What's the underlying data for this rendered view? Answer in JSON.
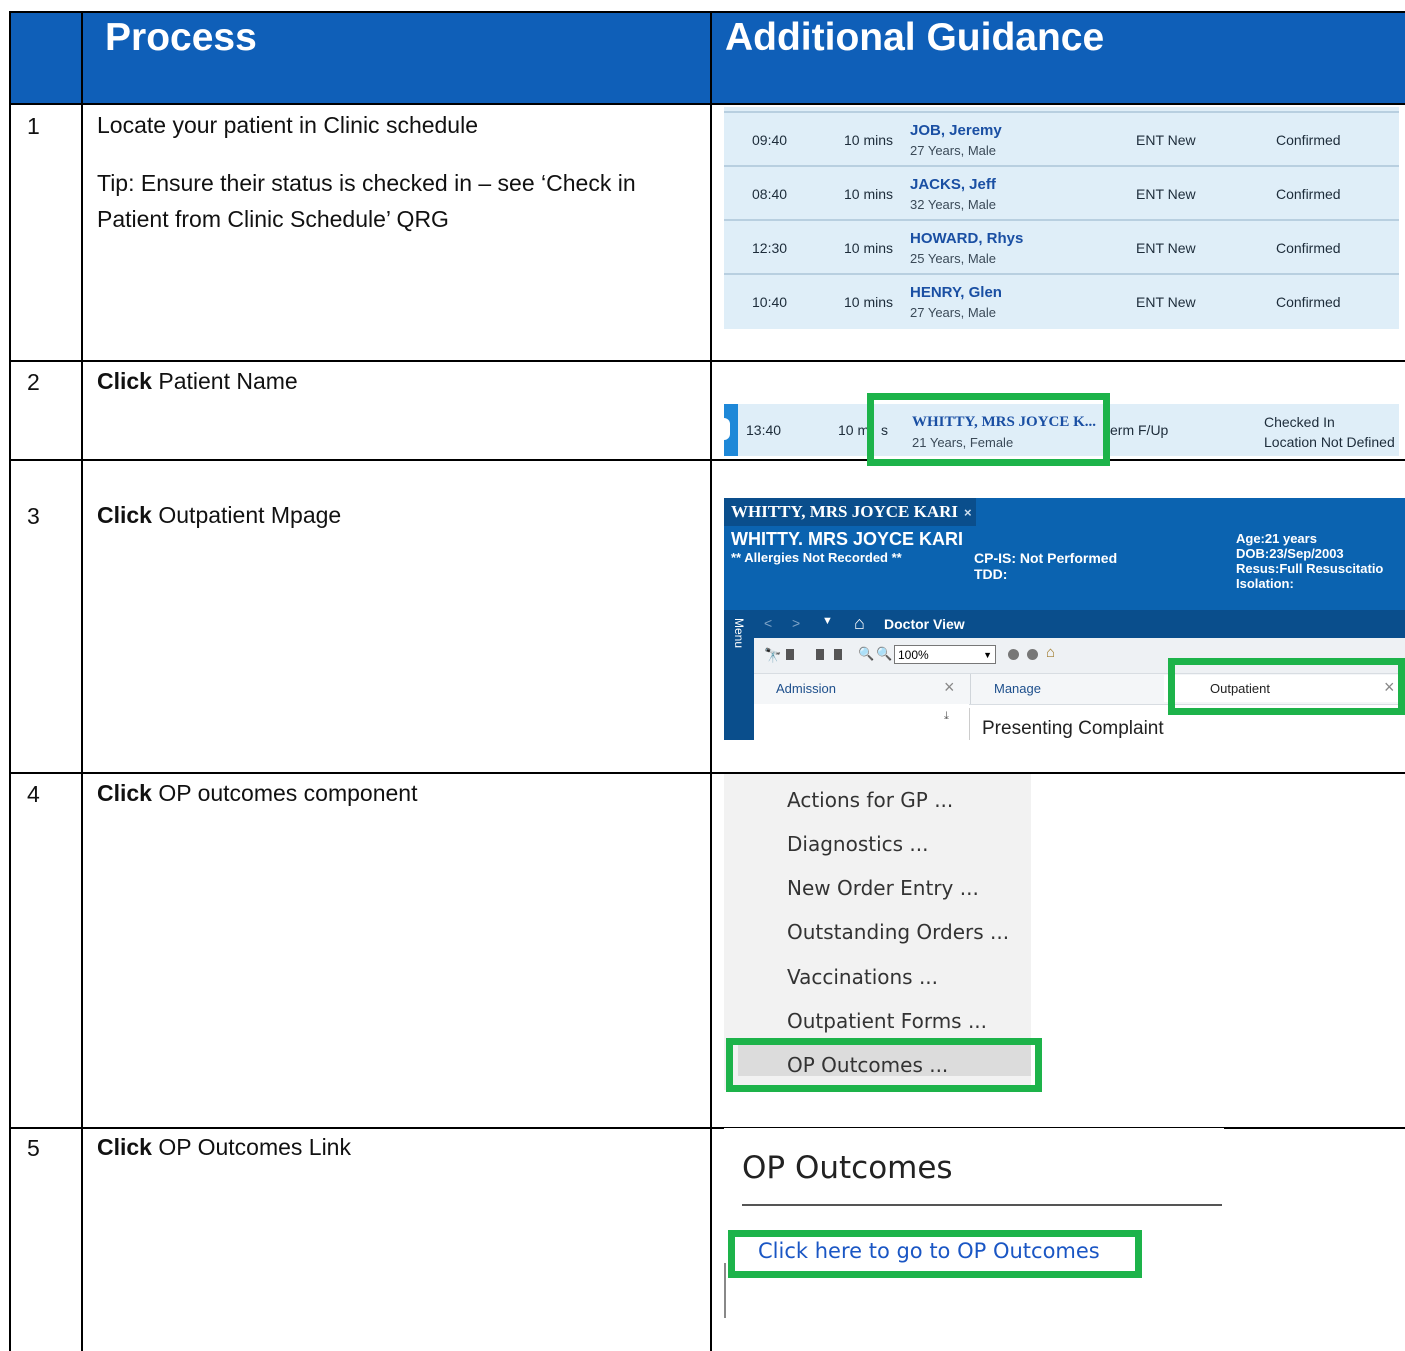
{
  "header": {
    "process": "Process",
    "guidance": "Additional Guidance"
  },
  "steps": [
    {
      "num": "1",
      "text": "Locate your patient in Clinic schedule",
      "tip": "Tip: Ensure their status is checked in  – see ‘Check in Patient from Clinic Schedule’ QRG"
    },
    {
      "num": "2",
      "bold": "Click",
      "text": " Patient Name"
    },
    {
      "num": "3",
      "bold": "Click",
      "text": " Outpatient Mpage"
    },
    {
      "num": "4",
      "bold": "Click",
      "text": " OP outcomes component"
    },
    {
      "num": "5",
      "bold": "Click",
      "text": " OP Outcomes Link"
    }
  ],
  "schedule": [
    {
      "time": "09:40",
      "dur": "10 mins",
      "name": "JOB, Jeremy",
      "sub": "27 Years, Male",
      "type": "ENT New",
      "status": "Confirmed"
    },
    {
      "time": "08:40",
      "dur": "10 mins",
      "name": "JACKS, Jeff",
      "sub": "32 Years, Male",
      "type": "ENT New",
      "status": "Confirmed"
    },
    {
      "time": "12:30",
      "dur": "10 mins",
      "name": "HOWARD, Rhys",
      "sub": "25 Years, Male",
      "type": "ENT New",
      "status": "Confirmed"
    },
    {
      "time": "10:40",
      "dur": "10 mins",
      "name": "HENRY, Glen",
      "sub": "27 Years, Male",
      "type": "ENT New",
      "status": "Confirmed"
    }
  ],
  "step2_row": {
    "time": "13:40",
    "dur_a": "10 m",
    "dur_b": "s",
    "name": "WHITTY, MRS JOYCE K...",
    "sub": "21 Years, Female",
    "type": "erm F/Up",
    "status1": "Checked In",
    "status2": "Location Not Defined"
  },
  "step3": {
    "tab": "WHITTY, MRS JOYCE KARI",
    "tab_close": "×",
    "name": "WHITTY. MRS JOYCE KARI",
    "allergies": "** Allergies Not Recorded **",
    "cpis": "CP-IS: Not Performed",
    "tdd": "TDD:",
    "age": "Age:21 years",
    "dob": "DOB:23/Sep/2003",
    "resus": "Resus:Full Resuscitatio",
    "isolation": "Isolation:",
    "menu": "Menu",
    "view": "Doctor View",
    "zoom": "100%",
    "tabs": [
      "Admission",
      "Manage",
      "Outpatient"
    ],
    "presenting": "Presenting Complaint",
    "pin": "⤓"
  },
  "step4": [
    "Actions for GP ...",
    "Diagnostics ...",
    "New Order Entry ...",
    "Outstanding Orders ...",
    "Vaccinations ...",
    "Outpatient Forms ...",
    "OP Outcomes ..."
  ],
  "step5": {
    "title": "OP Outcomes",
    "link": "Click here to go to OP Outcomes"
  },
  "colors": {
    "header": "#0f5fb8",
    "highlight": "#1db34a",
    "link": "#1a56c4"
  }
}
